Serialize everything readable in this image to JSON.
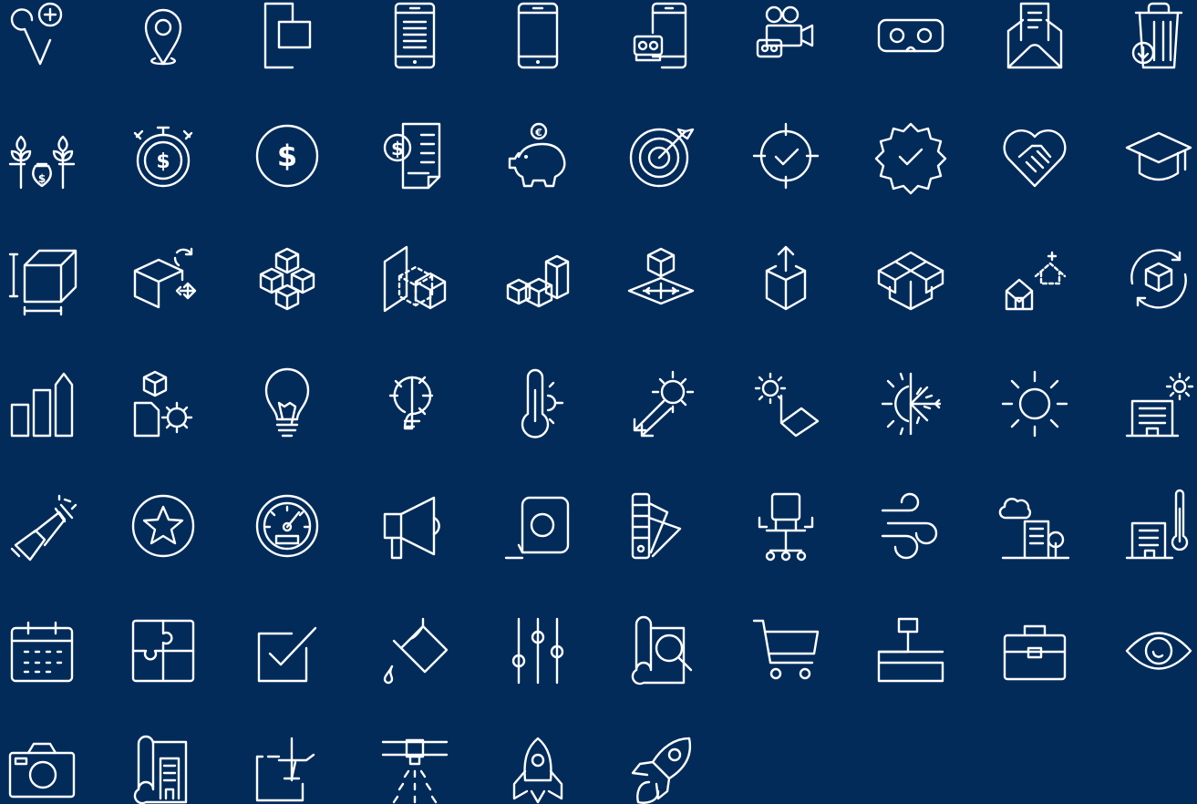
{
  "background_color": "#022b5a",
  "icon_color": "#ffffff",
  "icons": [
    "location-add-icon",
    "map-pin-icon",
    "responsive-screen-icon",
    "mobile-document-icon",
    "smartphone-icon",
    "mobile-vr-icon",
    "camera-crew-icon",
    "vr-headset-icon",
    "email-envelope-icon",
    "trash-download-icon",
    "money-growth-icon",
    "stopwatch-dollar-icon",
    "dollar-coin-icon",
    "invoice-icon",
    "piggy-bank-icon",
    "target-arrow-icon",
    "crosshair-check-icon",
    "verified-badge-icon",
    "handshake-heart-icon",
    "graduation-cap-icon",
    "cube-dimensions-icon",
    "cube-transform-icon",
    "cube-cluster-icon",
    "cube-projection-icon",
    "cube-blocks-icon",
    "cube-platform-icon",
    "cube-upload-icon",
    "open-box-icon",
    "house-build-icon",
    "cube-rotate-icon",
    "bar-chart-icon",
    "cube-document-sun-icon",
    "light-bulb-icon",
    "bulb-half-icon",
    "thermometer-sun-icon",
    "sun-rays-icon",
    "sun-angle-icon",
    "sun-snow-icon",
    "sun-icon",
    "building-sun-icon",
    "party-popper-icon",
    "star-circle-icon",
    "speedometer-icon",
    "megaphone-icon",
    "tape-measure-icon",
    "color-swatches-icon",
    "office-chair-icon",
    "wind-icon",
    "city-tree-icon",
    "building-thermometer-icon",
    "calendar-icon",
    "puzzle-icon",
    "checkbox-icon",
    "paint-bucket-icon",
    "sliders-icon",
    "blueprint-search-icon",
    "shopping-cart-icon",
    "desk-lamp-icon",
    "briefcase-icon",
    "eye-icon",
    "camera-icon",
    "blueprint-building-icon",
    "plane-map-icon",
    "sprinkler-icon",
    "rocket-icon",
    "rocket-launch-icon"
  ]
}
